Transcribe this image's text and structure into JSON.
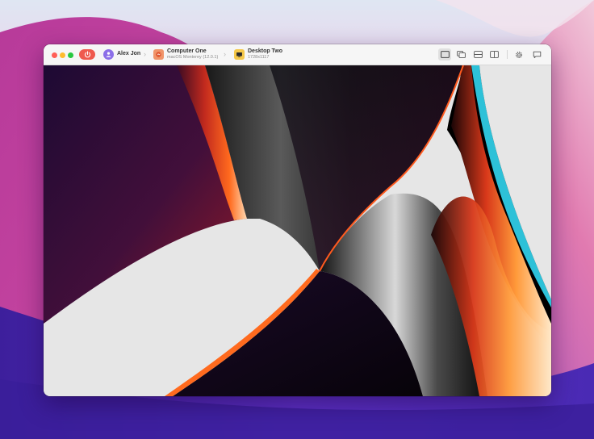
{
  "app": {
    "user": {
      "name": "Alex Jon",
      "icon": "person-icon",
      "color": "#8b6fe8"
    },
    "power": {
      "icon": "power-icon",
      "color": "#ef5a4e"
    },
    "computer": {
      "name": "Computer One",
      "subtitle": "macOS Monterey (12.0.1)",
      "icon": "macos-logo-icon",
      "color": "#f0956a"
    },
    "desktop": {
      "name": "Desktop Two",
      "resolution": "1728x1117",
      "icon": "display-icon",
      "color": "#f5c84a"
    },
    "toolbar": {
      "view_modes": [
        {
          "icon": "single-window-icon",
          "active": true
        },
        {
          "icon": "overlapping-windows-icon",
          "active": false
        },
        {
          "icon": "horizontal-split-icon",
          "active": false
        },
        {
          "icon": "vertical-split-icon",
          "active": false
        }
      ],
      "settings_icon": "gear-icon",
      "chat_icon": "chat-bubble-icon"
    }
  }
}
